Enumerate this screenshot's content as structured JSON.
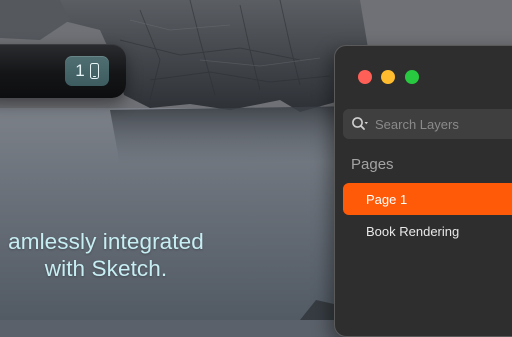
{
  "device_toolbar": {
    "count": "1",
    "device_icon": "phone-icon"
  },
  "tagline": {
    "line1": "amlessly integrated",
    "line2": "with Sketch."
  },
  "window": {
    "controls": [
      "close",
      "minimize",
      "zoom"
    ],
    "search": {
      "placeholder": "Search Layers",
      "icon": "search-icon"
    },
    "pages_title": "Pages",
    "pages": [
      {
        "label": "Page 1",
        "selected": true
      },
      {
        "label": "Book Rendering",
        "selected": false
      }
    ]
  },
  "colors": {
    "accent": "#ff5a08",
    "tagline": "#c7eef3",
    "chip": "#4f6f73",
    "close": "#fe5f57",
    "minimize": "#febc2e",
    "zoom": "#28c840"
  }
}
